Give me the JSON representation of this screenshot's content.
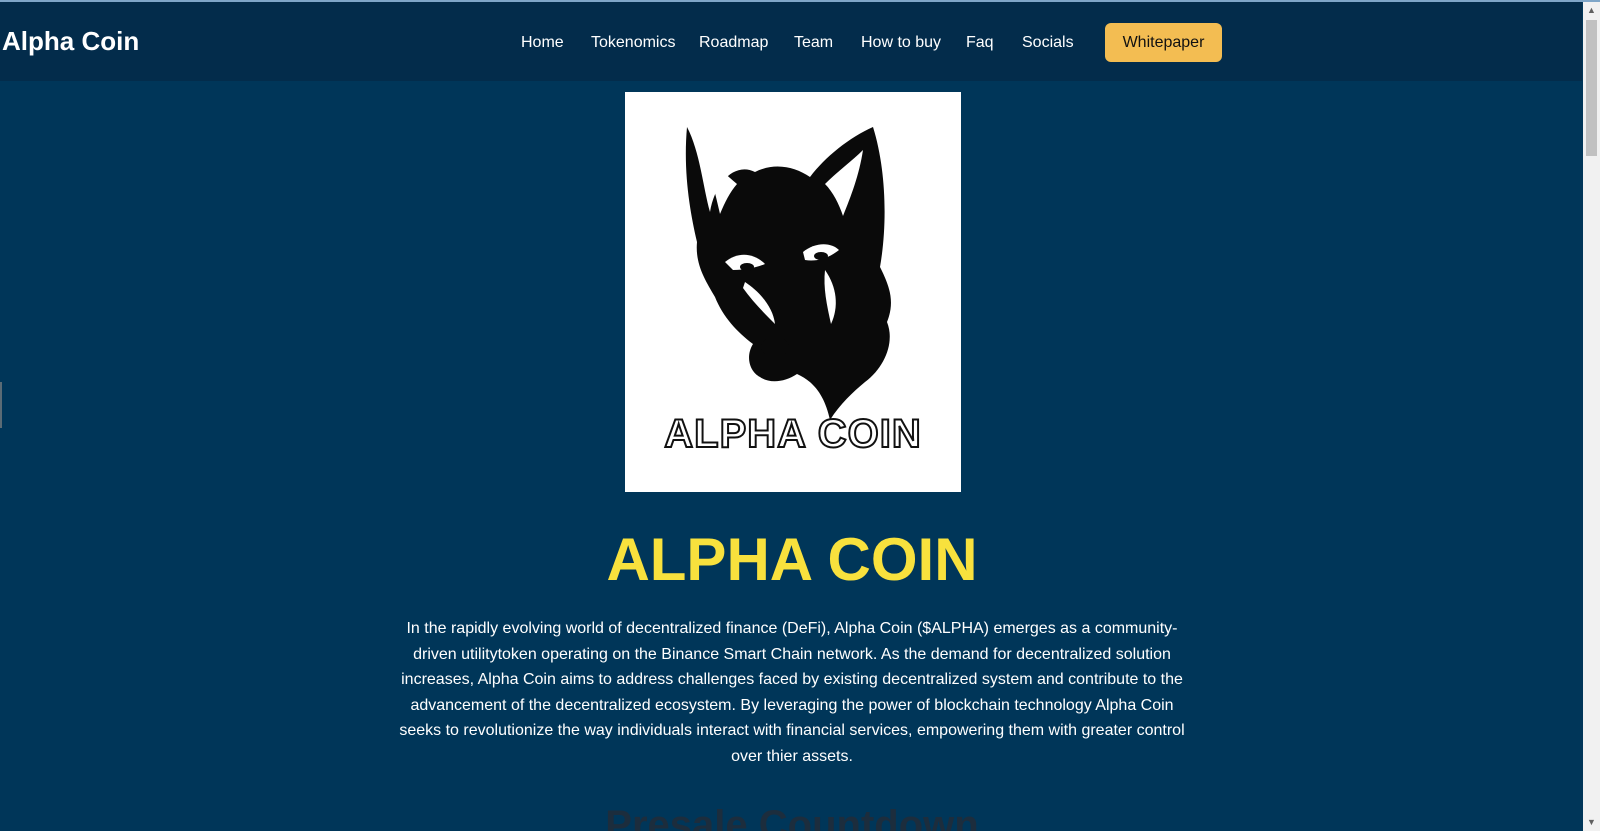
{
  "navbar": {
    "brand": "Alpha Coin",
    "links": [
      "Home",
      "Tokenomics",
      "Roadmap",
      "Team",
      "How to buy",
      "Faq",
      "Socials"
    ],
    "whitepaper_label": "Whitepaper"
  },
  "hero": {
    "logo_text": "ALPHA COIN",
    "title": "ALPHA COIN",
    "description": "In the rapidly evolving world of decentralized finance (DeFi), Alpha Coin ($ALPHA) emerges as a community-driven utilitytoken operating on the Binance Smart Chain network. As the demand for decentralized solution increases, Alpha Coin aims to address challenges faced by existing decentralized system and contribute to the advancement of the decentralized ecosystem. By leveraging the power of blockchain technology Alpha Coin seeks to revolutionize the way individuals interact with financial services, empowering them with greater control over thier assets."
  },
  "next_section": {
    "heading": "Presale Countdown"
  },
  "icons": {
    "logo": "wolf-head-icon",
    "scroll_up": "scroll-up-arrow-icon",
    "scroll_down": "scroll-down-arrow-icon"
  },
  "colors": {
    "background": "#003659",
    "navbar": "#032c4b",
    "accent_button": "#f3bd52",
    "title_yellow": "#f8e13d"
  }
}
